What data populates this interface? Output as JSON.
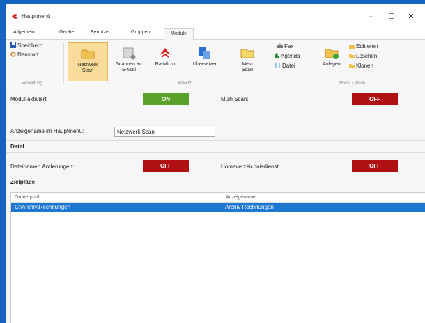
{
  "window": {
    "title": "Hauptmenü",
    "minimize": "–",
    "maximize": "☐",
    "close": "✕"
  },
  "tabs": [
    {
      "label": "Allgemein"
    },
    {
      "label": "Geräte"
    },
    {
      "label": "Benutzer"
    },
    {
      "label": "Gruppen"
    },
    {
      "label": "Module",
      "active": true
    }
  ],
  "ribbon": {
    "speichern": "Speichern",
    "neustart": "Neustart",
    "group_verwaltung": "Verwaltung",
    "netzwerk_scan": "Netzwerk Scan",
    "scannen_email": "Scannen an E-Mail",
    "ra_micro": "Ra-Micro",
    "uebersetzer": "Übersetzer",
    "meta_scan": "Meta Scan",
    "group_ansicht": "Ansicht",
    "fax": "Fax",
    "agenda": "Agenda",
    "datei": "Datei",
    "anlegen": "Anlegen",
    "editieren": "Editieren",
    "loeschen": "Löschen",
    "klonen": "Klonen",
    "group_module": "Modul / Pfade"
  },
  "settings": {
    "modul_aktiviert": "Modul aktiviert:",
    "modul_state": "ON",
    "multi_scan": "Multi Scan:",
    "multi_state": "OFF",
    "anzeigename_label": "Anzeigename im Hauptmenü:",
    "anzeigename_value": "Netzwerk Scan",
    "section_datei": "Datei",
    "dateinamen_label": "Dateinamen Änderungen:",
    "dateinamen_state": "OFF",
    "home_label": "Homeverzeichnisdienst:",
    "home_state": "OFF",
    "section_zielpfade": "Zielpfade"
  },
  "table": {
    "columns": [
      "Ordnerpfad",
      "Anzeigename"
    ],
    "rows": [
      {
        "ordnerpfad": "C:\\Archiv\\Rechnungen",
        "anzeigename": "Archiv Rechnungen"
      }
    ]
  },
  "colors": {
    "accent": "#1e78d2",
    "on": "#5aa02c",
    "off": "#b00f14",
    "selected_ribbon": "#f9dc9a"
  }
}
